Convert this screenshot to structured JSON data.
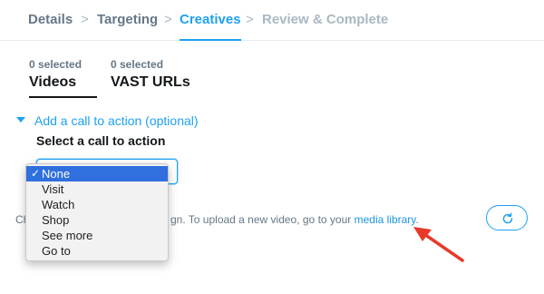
{
  "stepper": {
    "steps": [
      {
        "label": "Details",
        "state": "done"
      },
      {
        "label": "Targeting",
        "state": "done"
      },
      {
        "label": "Creatives",
        "state": "active"
      },
      {
        "label": "Review & Complete",
        "state": "future"
      }
    ],
    "separator": ">"
  },
  "media_tabs": [
    {
      "count": "0 selected",
      "label": "Videos",
      "selected": true
    },
    {
      "count": "0 selected",
      "label": "VAST URLs",
      "selected": false
    }
  ],
  "cta": {
    "toggle_label": "Add a call to action (optional)",
    "heading": "Select a call to action",
    "options": [
      "None",
      "Visit",
      "Watch",
      "Shop",
      "See more",
      "Go to"
    ],
    "selected": "None",
    "check_glyph": "✓"
  },
  "helper": {
    "prefix_visible": "Ch",
    "middle_visible": "gn. To upload a new video, go to your ",
    "link": "media library",
    "suffix": "."
  },
  "refresh_button": {
    "icon": "refresh-icon"
  },
  "annotation": {
    "arrow_color": "#e8392a"
  },
  "colors": {
    "accent": "#1da1f2",
    "text": "#14171a",
    "muted": "#657786",
    "future": "#aab8c2",
    "menu_highlight": "#2f6fde"
  }
}
